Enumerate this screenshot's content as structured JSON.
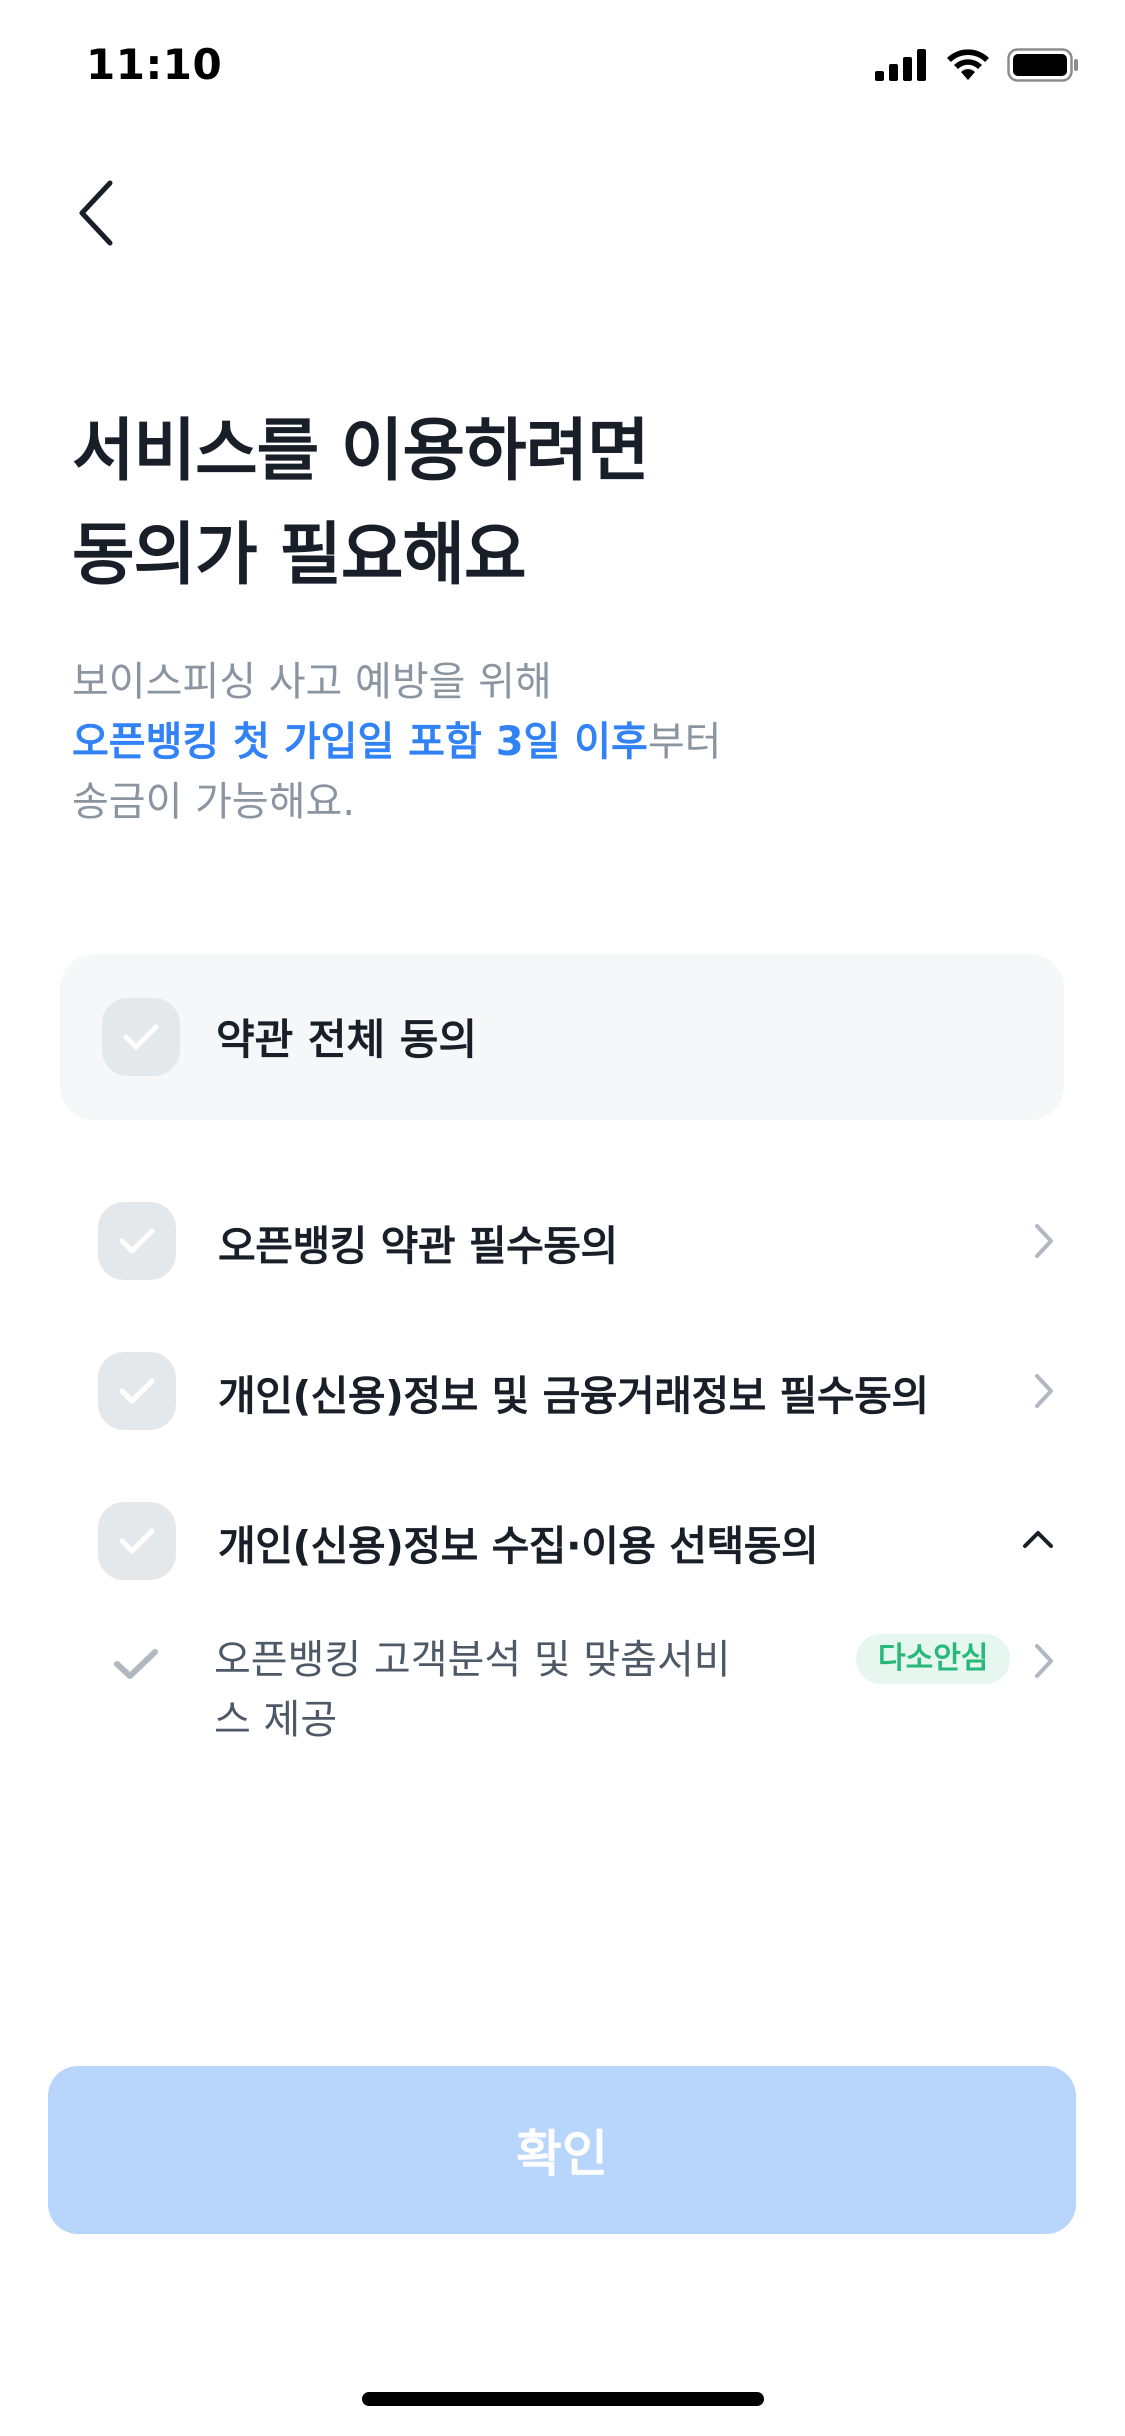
{
  "status_bar": {
    "time": "11:10",
    "icons": [
      "signal-icon",
      "wifi-icon",
      "battery-icon"
    ]
  },
  "nav": {
    "back_icon": "chevron-left-icon"
  },
  "header": {
    "title_line1": "서비스를 이용하려면",
    "title_line2": "동의가 필요해요"
  },
  "description": {
    "line1": "보이스피싱 사고 예방을 위해",
    "line2_highlight": "오픈뱅킹 첫 가입일 포함 3일 이후",
    "line2_rest": "부터",
    "line3": "송금이 가능해요."
  },
  "agree_all": {
    "label": "약관 전체 동의",
    "checked": false
  },
  "terms": [
    {
      "label": "오픈뱅킹 약관 필수동의",
      "checked": false,
      "expanded": false
    },
    {
      "label": "개인(신용)정보 및 금융거래정보 필수동의",
      "checked": false,
      "expanded": false
    },
    {
      "label": "개인(신용)정보 수집·이용 선택동의",
      "checked": false,
      "expanded": true
    }
  ],
  "sub_terms": [
    {
      "label": "오픈뱅킹 고객분석 및 맞춤서비스 제공",
      "badge": "다소안심"
    }
  ],
  "confirm_button": {
    "label": "확인",
    "enabled": false
  },
  "colors": {
    "primary": "#3182f6",
    "disabled_button": "#b8d5fb",
    "badge_bg": "#e5f7ee",
    "badge_text": "#28b878",
    "text_main": "#191f28",
    "text_sub": "#8b95a1"
  }
}
